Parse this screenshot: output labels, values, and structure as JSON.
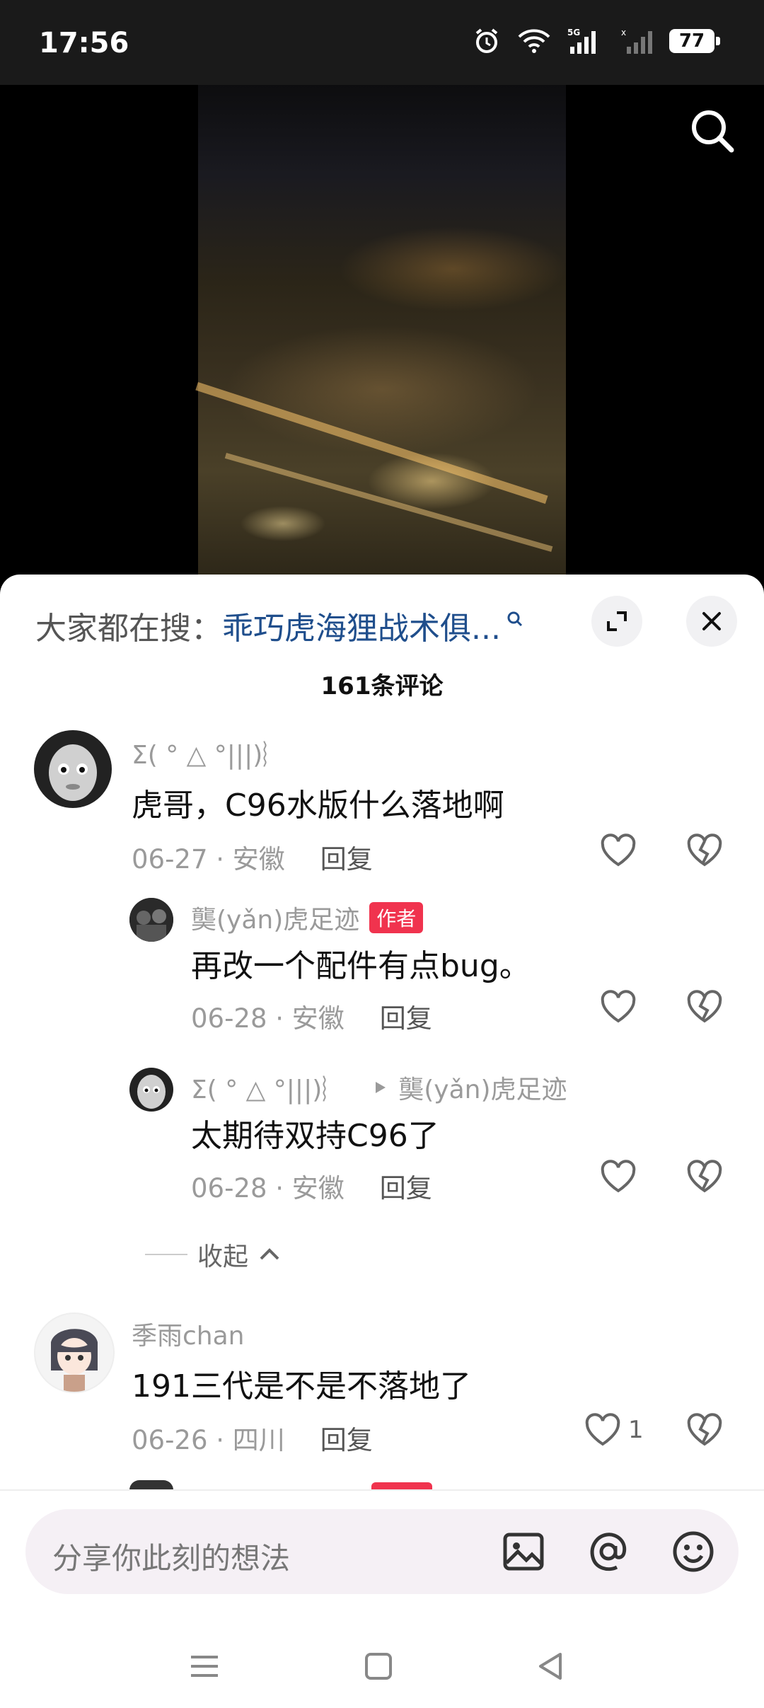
{
  "status_bar": {
    "time": "17:56",
    "battery": "77",
    "network": "5G"
  },
  "search_trend": {
    "prefix": "大家都在搜：",
    "query": "乖巧虎海狸战术俱..."
  },
  "comments_count": "161条评论",
  "comments": [
    {
      "user": "Σ( ° △ °|||)︴",
      "text": "虎哥，C96水版什么落地啊",
      "date": "06-27 · 安徽",
      "reply": "回复"
    },
    {
      "user": "龑(yǎn)虎足迹",
      "badge": "作者",
      "text": "再改一个配件有点bug。",
      "date": "06-28 · 安徽",
      "reply": "回复"
    },
    {
      "user": "Σ( ° △ °|||)︴",
      "reply_to": "龑(yǎn)虎足迹",
      "text": "太期待双持C96了",
      "date": "06-28 · 安徽",
      "reply": "回复"
    },
    {
      "user": "季雨chan",
      "text": "191三代是不是不落地了",
      "date": "06-26 · 四川",
      "reply": "回复",
      "likes": "1"
    }
  ],
  "collapse_label": "收起",
  "input": {
    "placeholder": "分享你此刻的想法"
  },
  "colors": {
    "accent": "#f0334e",
    "link": "#1f4e8c"
  }
}
